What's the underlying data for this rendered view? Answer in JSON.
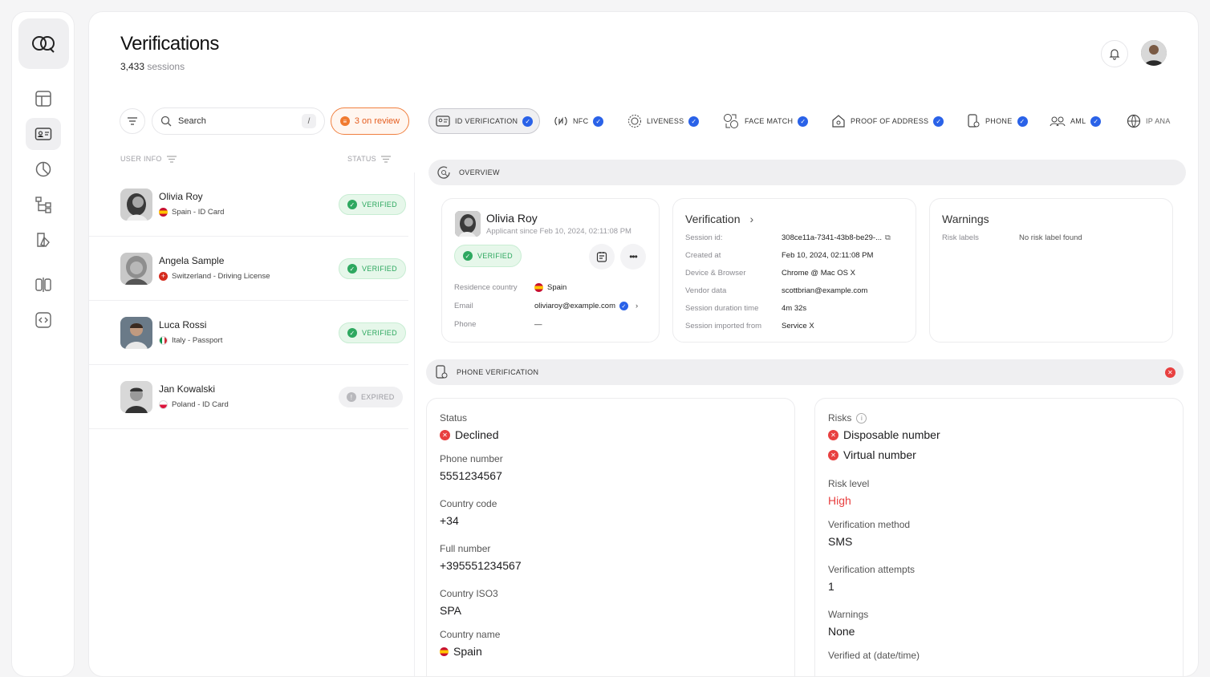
{
  "header": {
    "title": "Verifications",
    "sessions_count": "3,433",
    "sessions_label": "sessions"
  },
  "search": {
    "placeholder": "Search",
    "shortcut": "/"
  },
  "review_button": {
    "label": "3 on review"
  },
  "list": {
    "col_user": "USER INFO",
    "col_status": "STATUS",
    "rows": [
      {
        "name": "Olivia Roy",
        "sub": "Spain - ID Card",
        "status": "VERIFIED"
      },
      {
        "name": "Angela Sample",
        "sub": "Switzerland - Driving License",
        "status": "VERIFIED"
      },
      {
        "name": "Luca Rossi",
        "sub": "Italy - Passport",
        "status": "VERIFIED"
      },
      {
        "name": "Jan Kowalski",
        "sub": "Poland - ID Card",
        "status": "EXPIRED"
      }
    ]
  },
  "tabs": [
    "ID VERIFICATION",
    "NFC",
    "LIVENESS",
    "FACE MATCH",
    "PROOF OF ADDRESS",
    "PHONE",
    "AML",
    "IP ANA"
  ],
  "overview": {
    "label": "OVERVIEW",
    "applicant": {
      "name": "Olivia Roy",
      "since": "Applicant since Feb 10, 2024, 02:11:08 PM",
      "status": "VERIFIED",
      "residence_label": "Residence country",
      "residence_value": "Spain",
      "email_label": "Email",
      "email_value": "oliviaroy@example.com",
      "phone_label": "Phone",
      "phone_value": "—"
    },
    "verification": {
      "title": "Verification",
      "rows": [
        {
          "k": "Session id:",
          "v": "308ce11a-7341-43b8-be29-..."
        },
        {
          "k": "Created at",
          "v": "Feb 10, 2024, 02:11:08 PM"
        },
        {
          "k": "Device & Browser",
          "v": "Chrome @ Mac OS X"
        },
        {
          "k": "Vendor data",
          "v": "scottbrian@example.com"
        },
        {
          "k": "Session duration time",
          "v": "4m 32s"
        },
        {
          "k": "Session imported from",
          "v": "Service X"
        }
      ]
    },
    "warnings": {
      "title": "Warnings",
      "risk_label": "Risk labels",
      "risk_value": "No risk label found"
    }
  },
  "phone_verification": {
    "label": "PHONE VERIFICATION",
    "left": {
      "status_label": "Status",
      "status_value": "Declined",
      "phone_label": "Phone number",
      "phone_value": "5551234567",
      "cc_label": "Country code",
      "cc_value": "+34",
      "full_label": "Full number",
      "full_value": "+395551234567",
      "iso_label": "Country ISO3",
      "iso_value": "SPA",
      "cname_label": "Country name",
      "cname_value": "Spain"
    },
    "right": {
      "risks_label": "Risks",
      "risk1": "Disposable number",
      "risk2": "Virtual number",
      "level_label": "Risk level",
      "level_value": "High",
      "method_label": "Verification method",
      "method_value": "SMS",
      "attempts_label": "Verification attempts",
      "attempts_value": "1",
      "warnings_label": "Warnings",
      "warnings_value": "None",
      "verified_label": "Verified at (date/time)"
    }
  },
  "colors": {
    "accent_blue": "#2a62e8",
    "verified_green": "#2ea860",
    "danger_red": "#e84040",
    "review_orange": "#e55e20"
  }
}
